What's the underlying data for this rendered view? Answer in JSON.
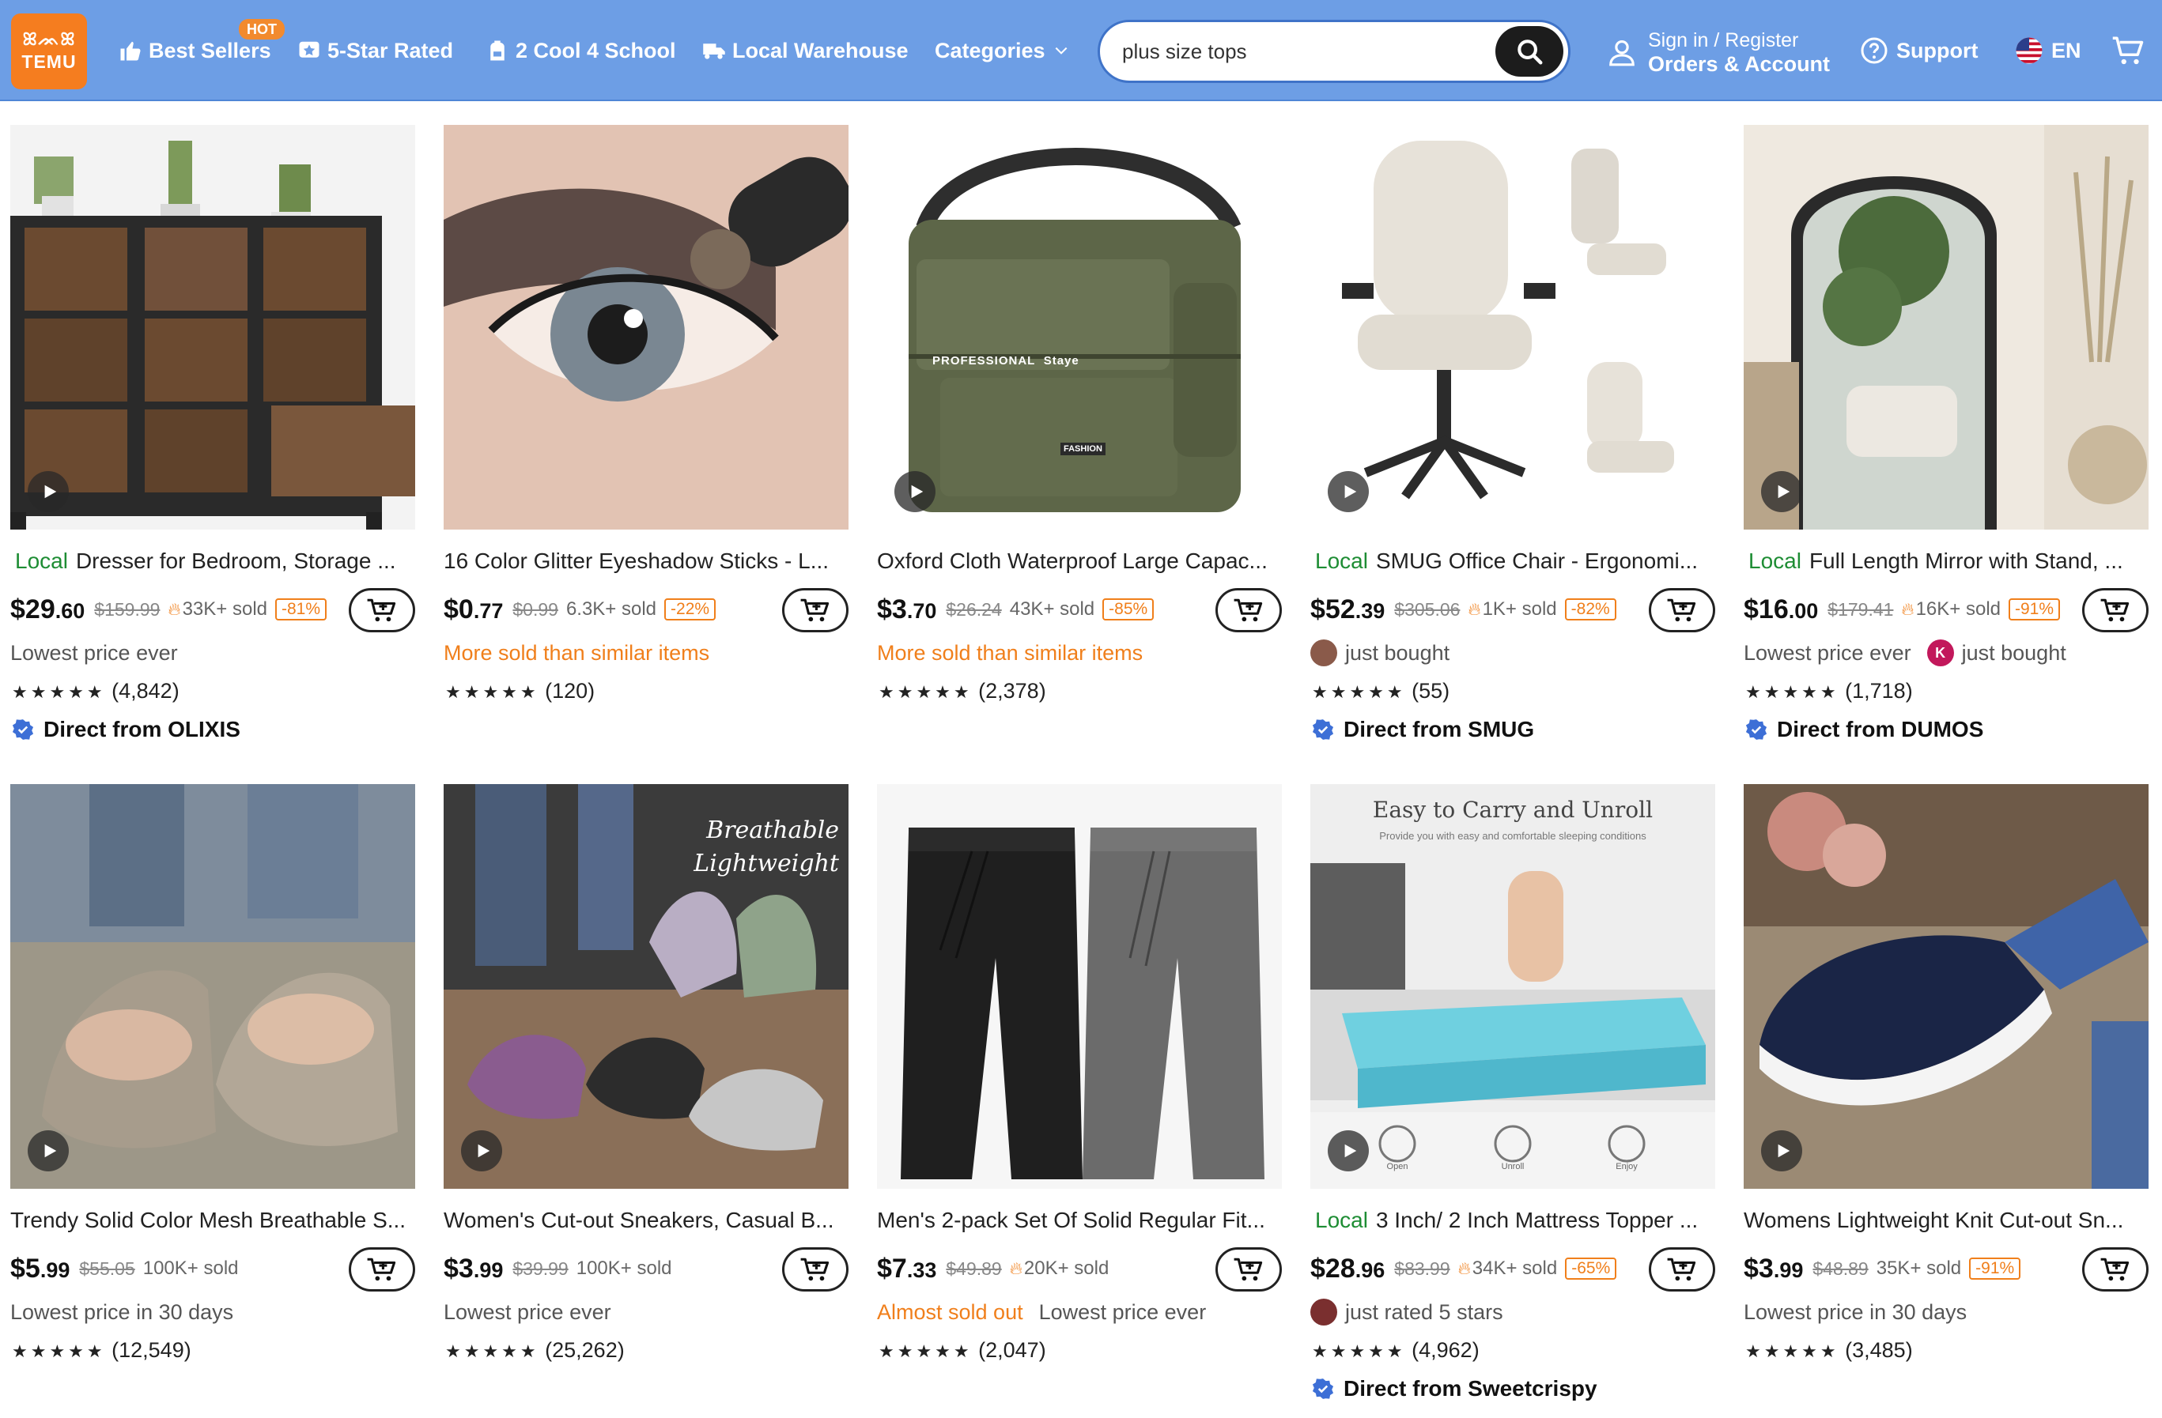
{
  "header": {
    "logo_glyphs": "ꕤᨏꕤ",
    "logo_word": "TEMU",
    "nav": [
      {
        "label": "Best Sellers",
        "badge": "HOT",
        "icon": "thumbs-up-icon"
      },
      {
        "label": "5-Star Rated",
        "icon": "star-badge-icon"
      },
      {
        "label": "2 Cool 4 School",
        "icon": "backpack-icon"
      },
      {
        "label": "Local Warehouse",
        "icon": "truck-icon"
      },
      {
        "label": "Categories",
        "icon": "chevron-down-icon"
      }
    ],
    "search": {
      "value": "plus size tops",
      "icon": "search-icon"
    },
    "account": {
      "line1": "Sign in / Register",
      "line2": "Orders & Account",
      "icon": "user-icon"
    },
    "support": {
      "label": "Support",
      "icon": "question-circle-icon"
    },
    "language": {
      "label": "EN",
      "icon": "us-flag-icon"
    },
    "cart_icon": "cart-icon"
  },
  "colors": {
    "header_bg": "#6d9ee5",
    "brand_orange": "#f57d1f",
    "local_green": "#1e8d34",
    "discount_orange": "#f07f1b",
    "verified_blue": "#3d6fd6"
  },
  "products": [
    {
      "local": "Local",
      "title": "Dresser for Bedroom, Storage ...",
      "price_main": "$29",
      "price_cents": ".60",
      "orig": "$159.99",
      "flame": true,
      "sold": "33K+ sold",
      "discount": "-81%",
      "sub": "Lowest price ever",
      "sub_style": "gray",
      "stars": "★★★★★",
      "reviews": "(4,842)",
      "direct": "Direct from OLIXIS",
      "video": true
    },
    {
      "local": "",
      "title": "16 Color Glitter Eyeshadow Sticks - L...",
      "price_main": "$0",
      "price_cents": ".77",
      "orig": "$0.99",
      "flame": false,
      "sold": "6.3K+ sold",
      "discount": "-22%",
      "sub": "More sold than similar items",
      "sub_style": "orange",
      "stars": "★★★★★",
      "reviews": "(120)",
      "direct": "",
      "video": false
    },
    {
      "local": "",
      "title": "Oxford Cloth Waterproof Large Capac...",
      "price_main": "$3",
      "price_cents": ".70",
      "orig": "$26.24",
      "flame": false,
      "sold": "43K+ sold",
      "discount": "-85%",
      "sub": "More sold than similar items",
      "sub_style": "orange",
      "stars": "★★★★★",
      "reviews": "(2,378)",
      "direct": "",
      "video": true,
      "image_text": [
        "PROFESSIONAL",
        "Staye",
        "FASHION"
      ]
    },
    {
      "local": "Local",
      "title": "SMUG Office Chair - Ergonomi...",
      "price_main": "$52",
      "price_cents": ".39",
      "orig": "$305.06",
      "flame": true,
      "sold": "1K+ sold",
      "discount": "-82%",
      "sub": "just bought",
      "sub_style": "gray",
      "sub_avatar": true,
      "stars": "★★★★★",
      "reviews": "(55)",
      "direct": "Direct from SMUG",
      "video": true
    },
    {
      "local": "Local",
      "title": "Full Length Mirror with Stand, ...",
      "price_main": "$16",
      "price_cents": ".00",
      "orig": "$179.41",
      "flame": true,
      "sold": "16K+ sold",
      "discount": "-91%",
      "sub": "Lowest price ever",
      "sub2": "just bought",
      "sub2_avatar_letter": "K",
      "sub_style": "gray",
      "stars": "★★★★★",
      "reviews": "(1,718)",
      "direct": "Direct from DUMOS",
      "video": true
    },
    {
      "local": "",
      "title": "Trendy Solid Color Mesh Breathable S...",
      "price_main": "$5",
      "price_cents": ".99",
      "orig": "$55.05",
      "flame": false,
      "sold": "100K+ sold",
      "discount": "",
      "sub": "Lowest price in 30 days",
      "sub_style": "gray",
      "stars": "★★★★★",
      "reviews": "(12,549)",
      "direct": "",
      "video": true
    },
    {
      "local": "",
      "title": "Women's Cut-out Sneakers, Casual B...",
      "price_main": "$3",
      "price_cents": ".99",
      "orig": "$39.99",
      "flame": false,
      "sold": "100K+ sold",
      "discount": "",
      "sub": "Lowest price ever",
      "sub_style": "gray",
      "stars": "★★★★★",
      "reviews": "(25,262)",
      "direct": "",
      "video": true,
      "image_text": [
        "Breathable",
        "Lightweight"
      ]
    },
    {
      "local": "",
      "title": "Men's 2-pack Set Of Solid Regular Fit...",
      "price_main": "$7",
      "price_cents": ".33",
      "orig": "$49.89",
      "flame": true,
      "sold": "20K+ sold",
      "discount": "",
      "sub": "Almost sold out",
      "sub2": "Lowest price ever",
      "sub_style": "orange",
      "stars": "★★★★★",
      "reviews": "(2,047)",
      "direct": "",
      "video": false
    },
    {
      "local": "Local",
      "title": "3 Inch/ 2 Inch Mattress Topper ...",
      "price_main": "$28",
      "price_cents": ".96",
      "orig": "$83.99",
      "flame": true,
      "sold": "34K+ sold",
      "discount": "-65%",
      "sub": "just rated 5 stars",
      "sub_style": "gray",
      "sub_avatar": true,
      "stars": "★★★★★",
      "reviews": "(4,962)",
      "direct": "Direct from Sweetcrispy",
      "video": true,
      "image_text": [
        "Easy to Carry and Unroll",
        "Provide you with easy and comfortable sleeping conditions",
        "Open",
        "Unroll",
        "Enjoy"
      ]
    },
    {
      "local": "",
      "title": "Womens Lightweight Knit Cut-out Sn...",
      "price_main": "$3",
      "price_cents": ".99",
      "orig": "$48.89",
      "flame": false,
      "sold": "35K+ sold",
      "discount": "-91%",
      "sub": "Lowest price in 30 days",
      "sub_style": "gray",
      "stars": "★★★★★",
      "reviews": "(3,485)",
      "direct": "",
      "video": true
    }
  ]
}
